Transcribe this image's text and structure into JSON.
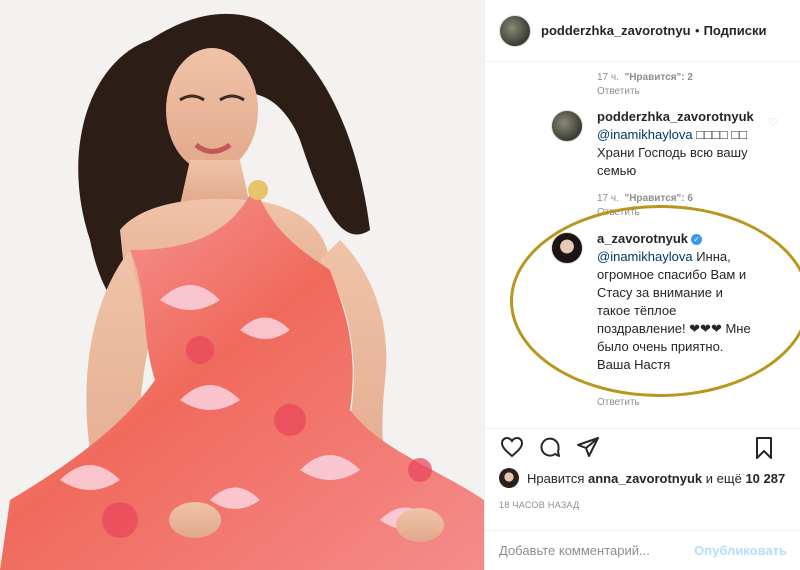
{
  "header": {
    "username": "podderzhka_zavorotnyuk",
    "separator": "•",
    "follow_label": "Подписки"
  },
  "comments": [
    {
      "type": "meta",
      "time": "17 ч.",
      "likes": "\"Нравится\": 2"
    },
    {
      "type": "comment",
      "user": "podderzhka_zavorotnyuk",
      "mention": "@inamikhaylova",
      "text": "□□□□ □□ Храни Господь всю вашу семью",
      "time": "17 ч.",
      "likes": "\"Нравится\": 6",
      "reply": "Ответить"
    },
    {
      "type": "comment",
      "user": "a_zavorotnyuk",
      "verified": true,
      "mention": "@inamikhaylova",
      "text": "Инна, огромное спасибо Вам и Стасу за внимание и такое тёплое поздравление! ❤❤❤ Мне было очень приятно. Ваша Настя",
      "reply": "Ответить"
    }
  ],
  "first_reply": "Ответить",
  "actions": {
    "like_icon": "heart-icon",
    "comment_icon": "comment-icon",
    "share_icon": "share-icon",
    "save_icon": "bookmark-icon"
  },
  "likes_line": {
    "prefix": "Нравится",
    "username": "anna_zavorotnyuk",
    "middle": "и ещё",
    "count": "10 287"
  },
  "time_ago": "18 ЧАСОВ НАЗАД",
  "add_comment": {
    "placeholder": "Добавьте комментарий...",
    "post_label": "Опубликовать"
  },
  "colors": {
    "ring": "#b8961f",
    "mention": "#00376b",
    "verified": "#3897f0",
    "post_disabled": "#b2dffc"
  }
}
